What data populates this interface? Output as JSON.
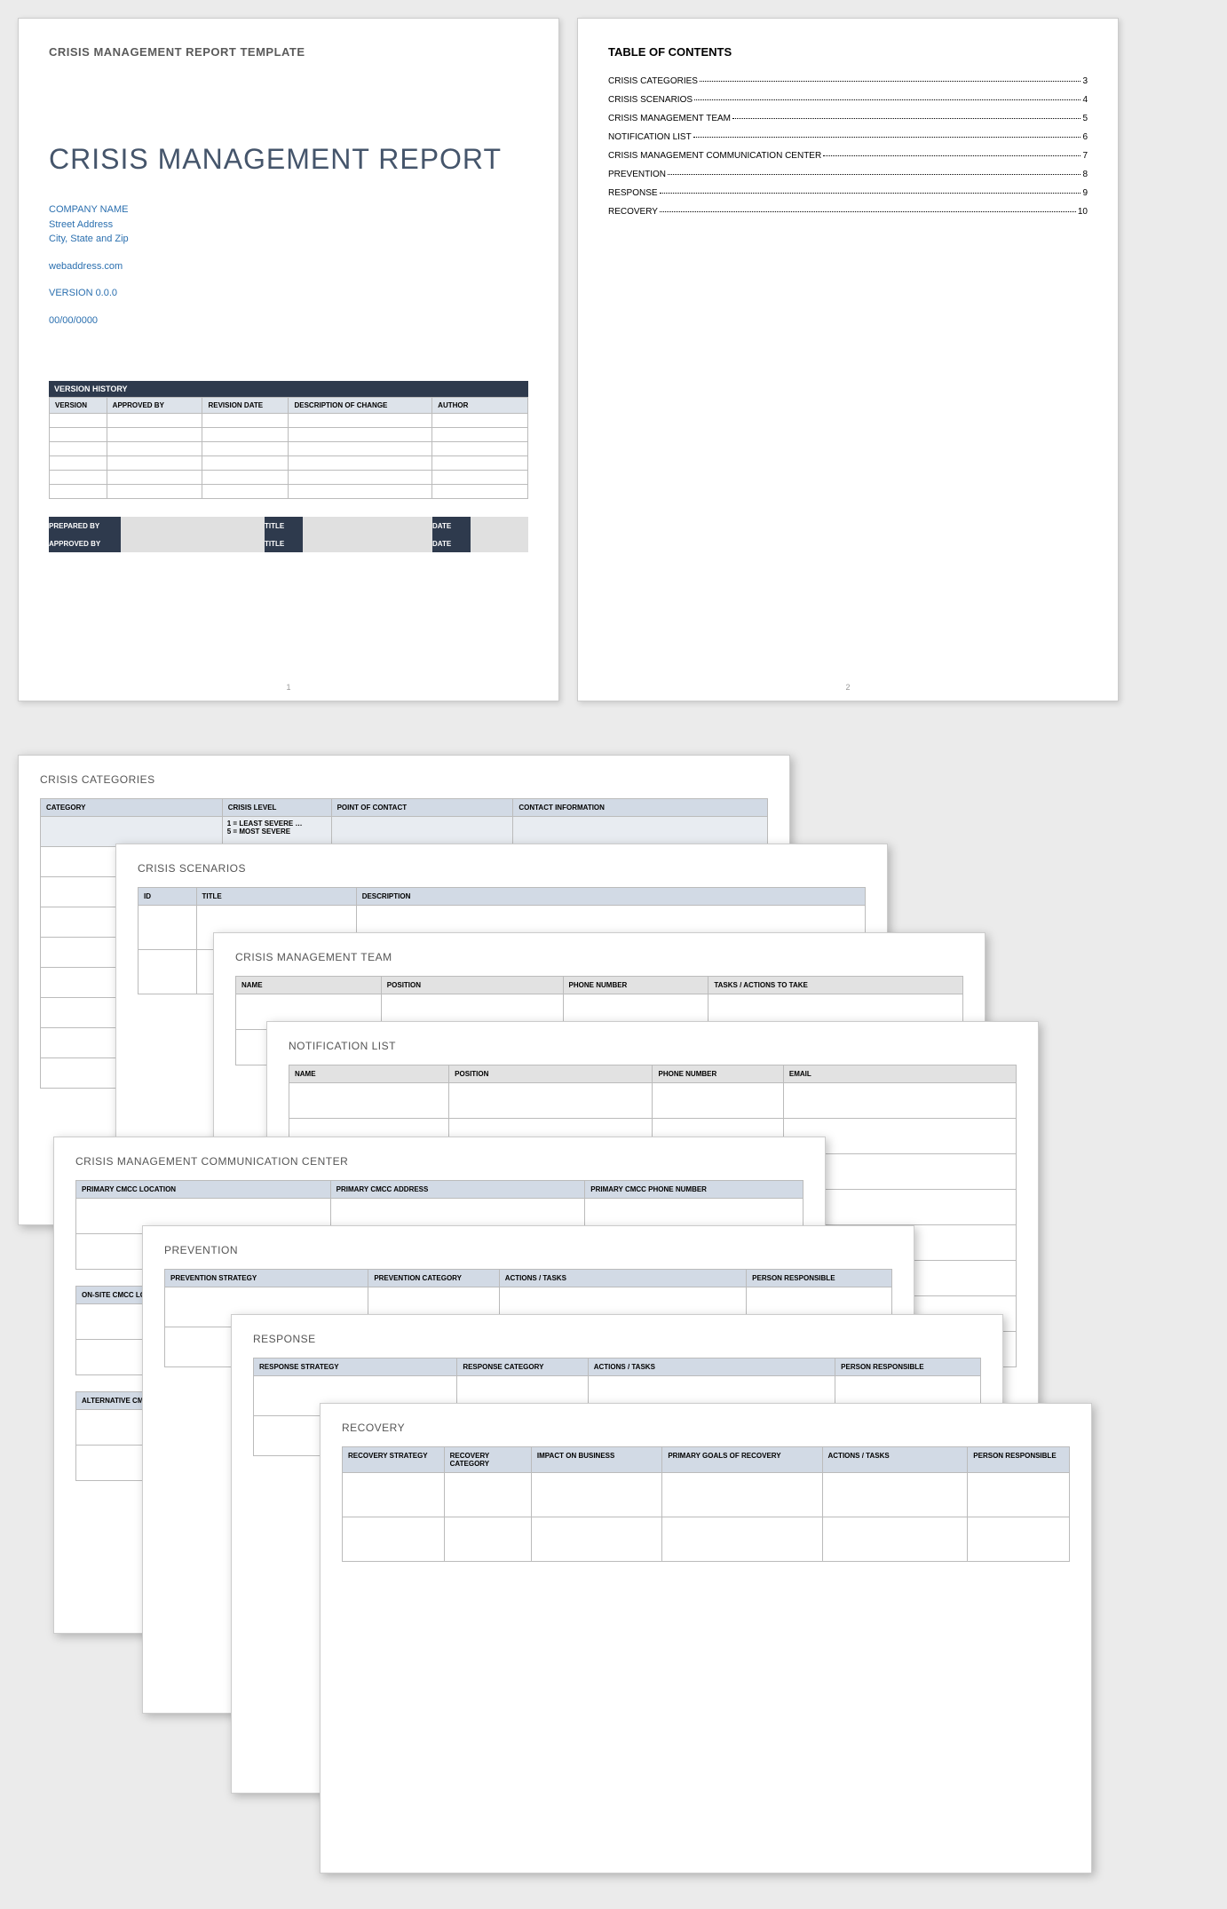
{
  "page1": {
    "template_label": "CRISIS MANAGEMENT REPORT TEMPLATE",
    "title": "CRISIS MANAGEMENT REPORT",
    "company": "COMPANY NAME",
    "street": "Street Address",
    "city": "City, State and Zip",
    "web": "webaddress.com",
    "version": "VERSION 0.0.0",
    "date": "00/00/0000",
    "vh_header": "VERSION HISTORY",
    "vh_cols": [
      "VERSION",
      "APPROVED BY",
      "REVISION DATE",
      "DESCRIPTION OF CHANGE",
      "AUTHOR"
    ],
    "sig": {
      "prepared": "PREPARED BY",
      "approved": "APPROVED BY",
      "title": "TITLE",
      "date": "DATE"
    },
    "pagenum": "1"
  },
  "page2": {
    "heading": "TABLE OF CONTENTS",
    "items": [
      {
        "label": "CRISIS CATEGORIES",
        "pg": "3"
      },
      {
        "label": "CRISIS SCENARIOS",
        "pg": "4"
      },
      {
        "label": "CRISIS MANAGEMENT TEAM",
        "pg": "5"
      },
      {
        "label": "NOTIFICATION LIST",
        "pg": "6"
      },
      {
        "label": "CRISIS MANAGEMENT COMMUNICATION CENTER",
        "pg": "7"
      },
      {
        "label": "PREVENTION",
        "pg": "8"
      },
      {
        "label": "RESPONSE",
        "pg": "9"
      },
      {
        "label": "RECOVERY",
        "pg": "10"
      }
    ],
    "pagenum": "2"
  },
  "p3": {
    "title": "CRISIS CATEGORIES",
    "cols": [
      "CATEGORY",
      "CRISIS LEVEL",
      "POINT OF CONTACT",
      "CONTACT INFORMATION"
    ],
    "level_note1": "1 = LEAST SEVERE …",
    "level_note2": "5 = MOST SEVERE"
  },
  "p4": {
    "title": "CRISIS SCENARIOS",
    "cols": [
      "ID",
      "TITLE",
      "DESCRIPTION"
    ]
  },
  "p5": {
    "title": "CRISIS MANAGEMENT TEAM",
    "cols": [
      "NAME",
      "POSITION",
      "PHONE NUMBER",
      "TASKS / ACTIONS TO TAKE"
    ]
  },
  "p6": {
    "title": "NOTIFICATION LIST",
    "cols": [
      "NAME",
      "POSITION",
      "PHONE NUMBER",
      "EMAIL"
    ]
  },
  "p7": {
    "title": "CRISIS MANAGEMENT COMMUNICATION CENTER",
    "cols": [
      "PRIMARY CMCC LOCATION",
      "PRIMARY CMCC ADDRESS",
      "PRIMARY CMCC PHONE NUMBER"
    ],
    "sub1": "ON-SITE CMCC LOCATION",
    "sub2": "ALTERNATIVE CMCC LOCATION"
  },
  "p8": {
    "title": "PREVENTION",
    "cols": [
      "PREVENTION STRATEGY",
      "PREVENTION CATEGORY",
      "ACTIONS / TASKS",
      "PERSON RESPONSIBLE"
    ]
  },
  "p9": {
    "title": "RESPONSE",
    "cols": [
      "RESPONSE STRATEGY",
      "RESPONSE CATEGORY",
      "ACTIONS / TASKS",
      "PERSON RESPONSIBLE"
    ]
  },
  "p10": {
    "title": "RECOVERY",
    "cols": [
      "RECOVERY STRATEGY",
      "RECOVERY CATEGORY",
      "IMPACT ON BUSINESS",
      "PRIMARY GOALS OF RECOVERY",
      "ACTIONS / TASKS",
      "PERSON RESPONSIBLE"
    ]
  }
}
